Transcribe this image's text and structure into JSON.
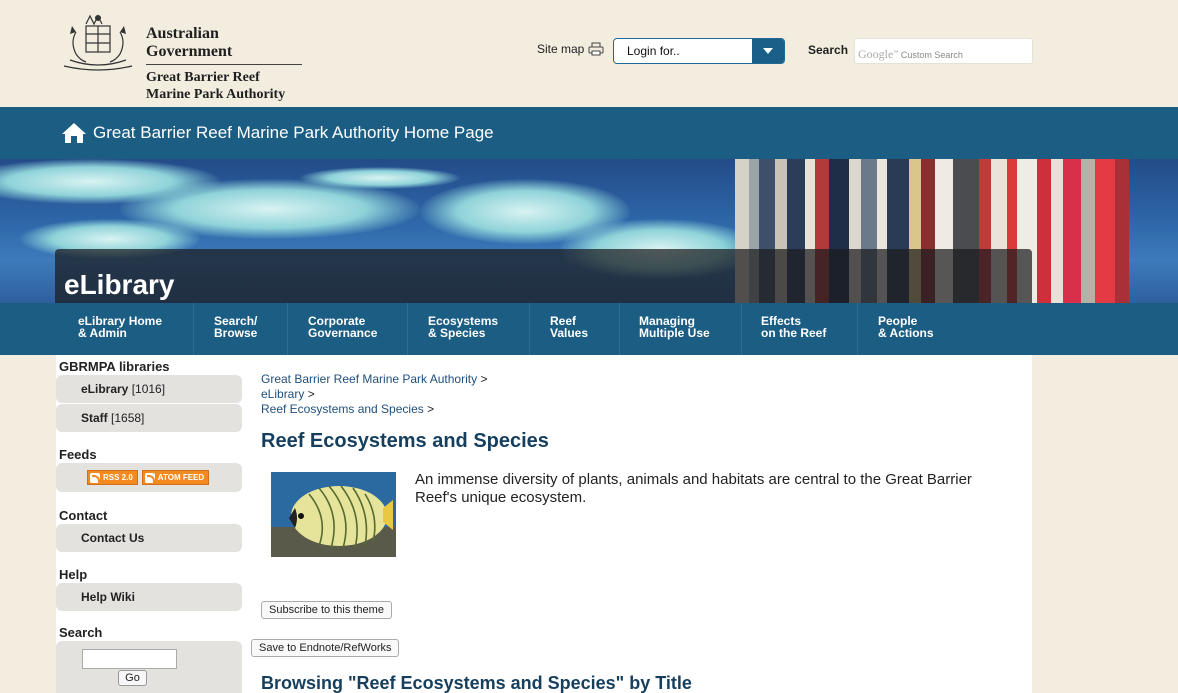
{
  "header": {
    "gov_title": "Australian Government",
    "agency_line1": "Great Barrier Reef",
    "agency_line2": "Marine Park Authority",
    "sitemap_label": "Site map",
    "login_label": "Login for..",
    "search_label": "Search",
    "search_placeholder_brand": "Google",
    "search_placeholder_text": "Custom Search"
  },
  "homebar": {
    "label": "Great Barrier Reef Marine Park Authority Home Page"
  },
  "banner": {
    "title": "eLibrary"
  },
  "nav": [
    {
      "line1": "eLibrary Home",
      "line2": "& Admin"
    },
    {
      "line1": "Search/",
      "line2": "Browse"
    },
    {
      "line1": "Corporate",
      "line2": "Governance"
    },
    {
      "line1": "Ecosystems",
      "line2": "& Species"
    },
    {
      "line1": "Reef",
      "line2": "Values"
    },
    {
      "line1": "Managing",
      "line2": "Multiple Use"
    },
    {
      "line1": "Effects",
      "line2": "on the Reef"
    },
    {
      "line1": "People",
      "line2": "& Actions"
    }
  ],
  "sidebar": {
    "libraries_heading": "GBRMPA libraries",
    "libraries": [
      {
        "label": "eLibrary",
        "count": "[1016]"
      },
      {
        "label": "Staff",
        "count": "[1658]"
      }
    ],
    "feeds_heading": "Feeds",
    "feeds": [
      "RSS 2.0",
      "ATOM FEED"
    ],
    "contact_heading": "Contact",
    "contact_button": "Contact Us",
    "help_heading": "Help",
    "help_button": "Help Wiki",
    "search_heading": "Search",
    "go_button": "Go"
  },
  "breadcrumb": [
    "Great Barrier Reef Marine Park Authority",
    "eLibrary",
    "Reef Ecosystems and Species"
  ],
  "breadcrumb_sep": ">",
  "main": {
    "title": "Reef Ecosystems and Species",
    "intro": "An immense diversity of plants, animals and habitats are central to the Great Barrier Reef's unique ecosystem.",
    "subscribe_button": "Subscribe to this theme",
    "save_button": "Save to Endnote/RefWorks",
    "browse_title": "Browsing \"Reef Ecosystems and Species\" by Title"
  },
  "colors": {
    "page_bg": "#f3ede0",
    "brand_blue": "#1c5d84",
    "title_blue": "#163f5e",
    "link_blue": "#1f4f7d"
  },
  "icons": [
    "crest-logo-icon",
    "printer-icon",
    "chevron-down-icon",
    "home-icon",
    "rss-icon",
    "atom-icon"
  ]
}
